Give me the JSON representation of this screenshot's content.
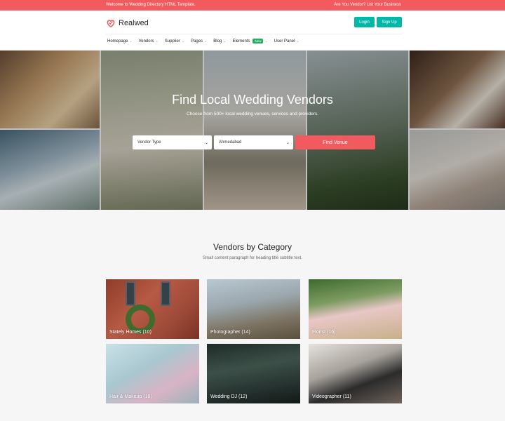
{
  "topbar": {
    "welcome": "Welcome to Wedding Directory HTML Template.",
    "vendor_cta": "Are You Vendor? List Your Business"
  },
  "header": {
    "brand": "Realwed",
    "login": "Login",
    "signup": "Sign Up"
  },
  "nav": {
    "items": [
      {
        "label": "Homepage"
      },
      {
        "label": "Vendors"
      },
      {
        "label": "Supplier"
      },
      {
        "label": "Pages"
      },
      {
        "label": "Blog"
      },
      {
        "label": "Elements",
        "badge": "New"
      },
      {
        "label": "User Panel"
      }
    ]
  },
  "hero": {
    "title": "Find Local Wedding Vendors",
    "subtitle": "Choose from 500+ local wedding venues, services and providers.",
    "vendor_type": "Vendor Type",
    "city": "Ahmedabad",
    "find_button": "Find Venue"
  },
  "categories": {
    "title": "Vendors by Category",
    "subtitle": "Small content paragraph for heading title subtitle text.",
    "items": [
      {
        "label": "Stately Homes (10)"
      },
      {
        "label": "Photographer (14)"
      },
      {
        "label": "Florist (16)"
      },
      {
        "label": "Hair & Makeup (18)"
      },
      {
        "label": "Wedding DJ (12)"
      },
      {
        "label": "Videographer (11)"
      }
    ]
  },
  "colors": {
    "accent": "#f15a5f",
    "teal": "#00b7a8",
    "badge": "#27ae60"
  }
}
